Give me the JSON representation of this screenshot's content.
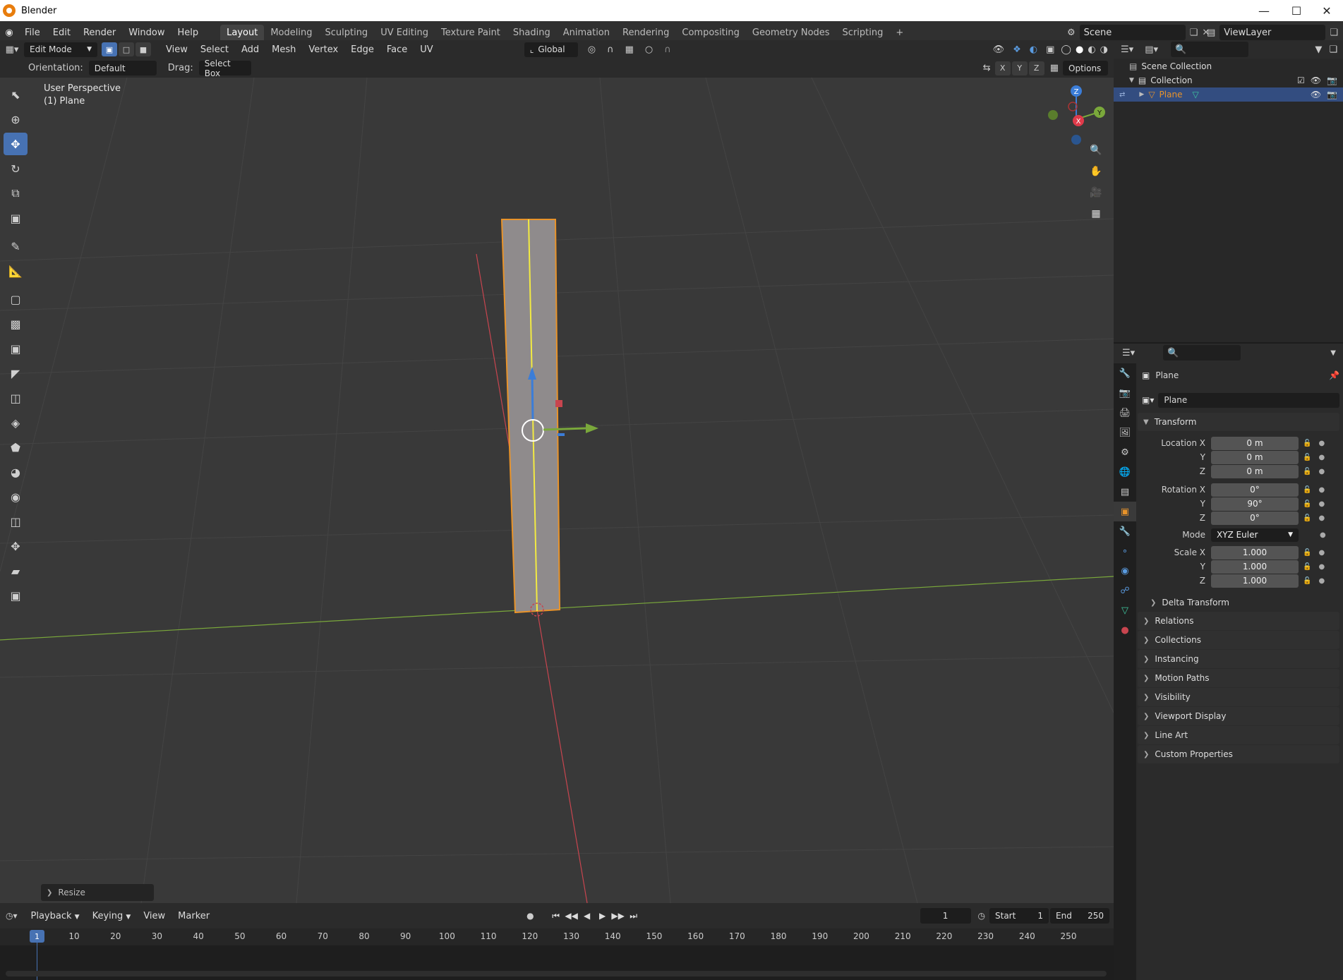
{
  "window": {
    "title": "Blender"
  },
  "menu": [
    "File",
    "Edit",
    "Render",
    "Window",
    "Help"
  ],
  "workspaces": [
    "Layout",
    "Modeling",
    "Sculpting",
    "UV Editing",
    "Texture Paint",
    "Shading",
    "Animation",
    "Rendering",
    "Compositing",
    "Geometry Nodes",
    "Scripting"
  ],
  "workspace_add": "+",
  "scene": {
    "name": "Scene",
    "view_layer": "ViewLayer"
  },
  "header": {
    "mode": "Edit Mode",
    "menus": [
      "View",
      "Select",
      "Add",
      "Mesh",
      "Vertex",
      "Edge",
      "Face",
      "UV"
    ],
    "transform_orientation": "Global",
    "options_label": "Options",
    "axes": [
      "X",
      "Y",
      "Z"
    ]
  },
  "tool_header": {
    "orientation_label": "Orientation:",
    "orientation_value": "Default",
    "drag_label": "Drag:",
    "drag_value": "Select Box"
  },
  "viewport": {
    "perspective": "User Perspective",
    "object": "(1) Plane",
    "gizmo": {
      "z": "Z",
      "x": "X",
      "y": "Y"
    },
    "last_op": "Resize"
  },
  "outliner": {
    "rows": [
      {
        "label": "Scene Collection"
      },
      {
        "label": "Collection"
      },
      {
        "label": "Plane"
      }
    ]
  },
  "properties": {
    "object_name": "Plane",
    "data_name": "Plane",
    "transform_title": "Transform",
    "fields": [
      {
        "label": "Location X",
        "value": "0 m"
      },
      {
        "label": "Y",
        "value": "0 m"
      },
      {
        "label": "Z",
        "value": "0 m"
      },
      {
        "label": "Rotation X",
        "value": "0°"
      },
      {
        "label": "Y",
        "value": "90°"
      },
      {
        "label": "Z",
        "value": "0°"
      },
      {
        "label": "Mode",
        "value": "XYZ Euler"
      },
      {
        "label": "Scale X",
        "value": "1.000"
      },
      {
        "label": "Y",
        "value": "1.000"
      },
      {
        "label": "Z",
        "value": "1.000"
      }
    ],
    "delta_transform": "Delta Transform",
    "panels": [
      "Relations",
      "Collections",
      "Instancing",
      "Motion Paths",
      "Visibility",
      "Viewport Display",
      "Line Art",
      "Custom Properties"
    ]
  },
  "timeline": {
    "menus": [
      "Playback",
      "Keying",
      "View",
      "Marker"
    ],
    "current_frame": "1",
    "start_label": "Start",
    "start": "1",
    "end_label": "End",
    "end": "250",
    "playhead": "1",
    "ruler": [
      "10",
      "20",
      "30",
      "40",
      "50",
      "60",
      "70",
      "80",
      "90",
      "100",
      "110",
      "120",
      "130",
      "140",
      "150",
      "160",
      "170",
      "180",
      "190",
      "200",
      "210",
      "220",
      "230",
      "240",
      "250"
    ]
  },
  "colors": {
    "accent": "#4772b3",
    "selection_orange": "#e8932a",
    "x_axis": "#c8454f",
    "y_axis": "#7aa83b",
    "z_axis": "#3b7dd8"
  }
}
